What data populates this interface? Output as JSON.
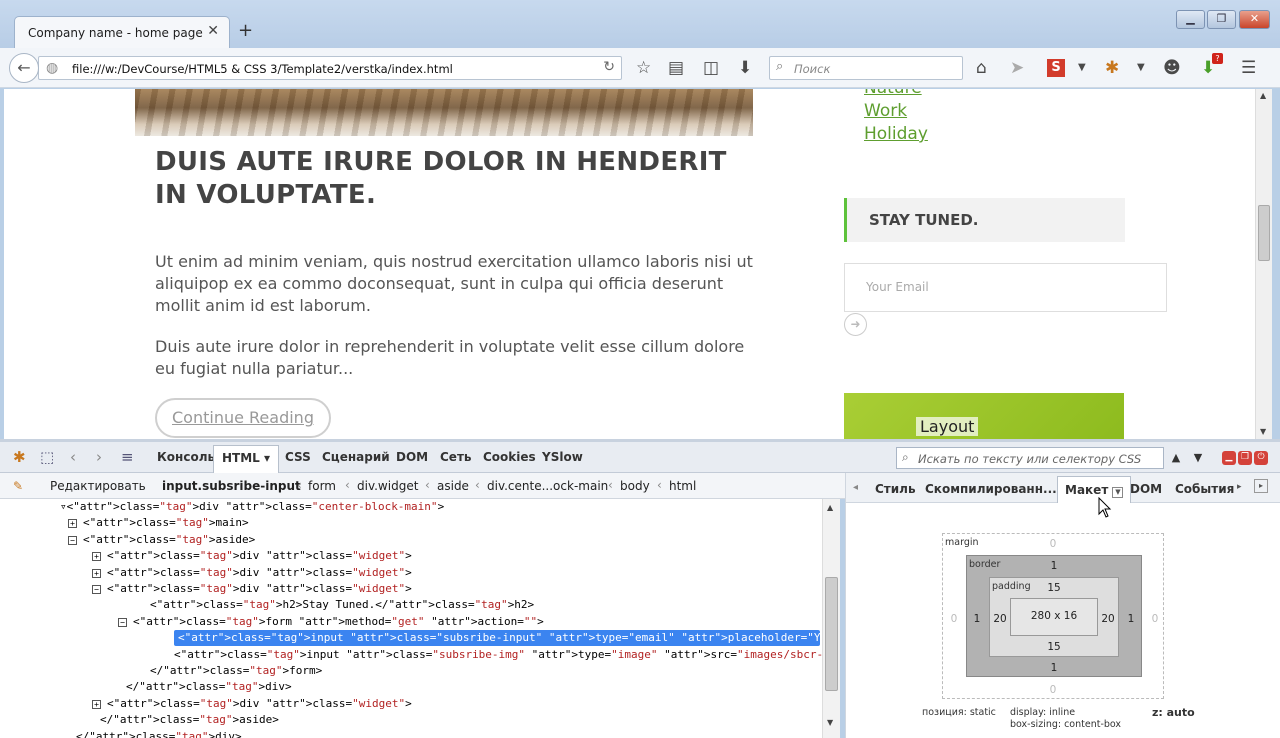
{
  "browser": {
    "tab_title": "Company name - home page",
    "url": "file:///w:/DevCourse/HTML5 & CSS 3/Template2/verstka/index.html",
    "search_placeholder": "Поиск",
    "notification_badge": "?"
  },
  "page": {
    "post_title": "DUIS AUTE IRURE DOLOR IN HENDERIT IN VOLUPTATE.",
    "paragraph_1": "Ut enim ad minim veniam, quis nostrud exercitation ullamco laboris nisi ut aliquipop ex ea commo doconsequat, sunt in culpa qui officia deserunt mollit anim id est laborum.",
    "paragraph_2": "Duis aute irure dolor in reprehenderit in voluptate velit esse cillum dolore eu fugiat nulla pariatur...",
    "read_more": "Continue Reading",
    "categories": [
      "Nature",
      "Work",
      "Holiday"
    ],
    "stay_tuned": "STAY TUNED.",
    "email_placeholder": "Your Email",
    "banner_text": "Layout"
  },
  "devtools": {
    "tabs": [
      "Консоль",
      "HTML",
      "CSS",
      "Сценарий",
      "DOM",
      "Сеть",
      "Cookies",
      "YSlow"
    ],
    "active_tab": "HTML",
    "search_placeholder": "Искать по тексту или селектору CSS",
    "edit_button": "Редактировать",
    "breadcrumb": [
      "input.subsribe-input",
      "form",
      "div.widget",
      "aside",
      "div.cente...ock-main",
      "body",
      "html"
    ],
    "side_tabs": [
      "Стиль",
      "Скомпилированн...",
      "Макет",
      "DOM",
      "События"
    ],
    "active_side_tab": "Макет",
    "code_lines": [
      {
        "t": "▿<div class=\"center-block-main\">",
        "indent": 60
      },
      {
        "t": "<main>",
        "indent": 84,
        "toggle": "+"
      },
      {
        "t": "<aside>",
        "indent": 84,
        "toggle": "-"
      },
      {
        "t": "<div class=\"widget\">",
        "indent": 108,
        "toggle": "+"
      },
      {
        "t": "<div class=\"widget\">",
        "indent": 108,
        "toggle": "+"
      },
      {
        "t": "<div class=\"widget\">",
        "indent": 108,
        "toggle": "-"
      },
      {
        "t": "<h2>Stay Tuned.</h2>",
        "indent": 150
      },
      {
        "t": "<form method=\"get\" action=\"\">",
        "indent": 134,
        "toggle": "-"
      },
      {
        "t": "<input class=\"subsribe-input\" type=\"email\" placeholder=\"Your Email\">",
        "indent": 174,
        "selected": true
      },
      {
        "t": "<input class=\"subsribe-img\" type=\"image\" src=\"images/sbcr-btn.jpg\">",
        "indent": 174
      },
      {
        "t": "</form>",
        "indent": 150
      },
      {
        "t": "</div>",
        "indent": 126
      },
      {
        "t": "<div class=\"widget\">",
        "indent": 108,
        "toggle": "+"
      },
      {
        "t": "</aside>",
        "indent": 100
      },
      {
        "t": "</div>",
        "indent": 76
      }
    ],
    "box_model": {
      "margin_label": "margin",
      "border_label": "border",
      "padding_label": "padding",
      "margin": {
        "top": "0",
        "right": "0",
        "bottom": "0",
        "left": "0"
      },
      "border": {
        "top": "1",
        "right": "1",
        "bottom": "1",
        "left": "1"
      },
      "padding": {
        "top": "15",
        "right": "20",
        "bottom": "15",
        "left": "20"
      },
      "content": "280 x 16",
      "position": "позиция: static",
      "display": "display: inline",
      "box_sizing": "box-sizing: content-box",
      "z": "z: auto"
    }
  }
}
